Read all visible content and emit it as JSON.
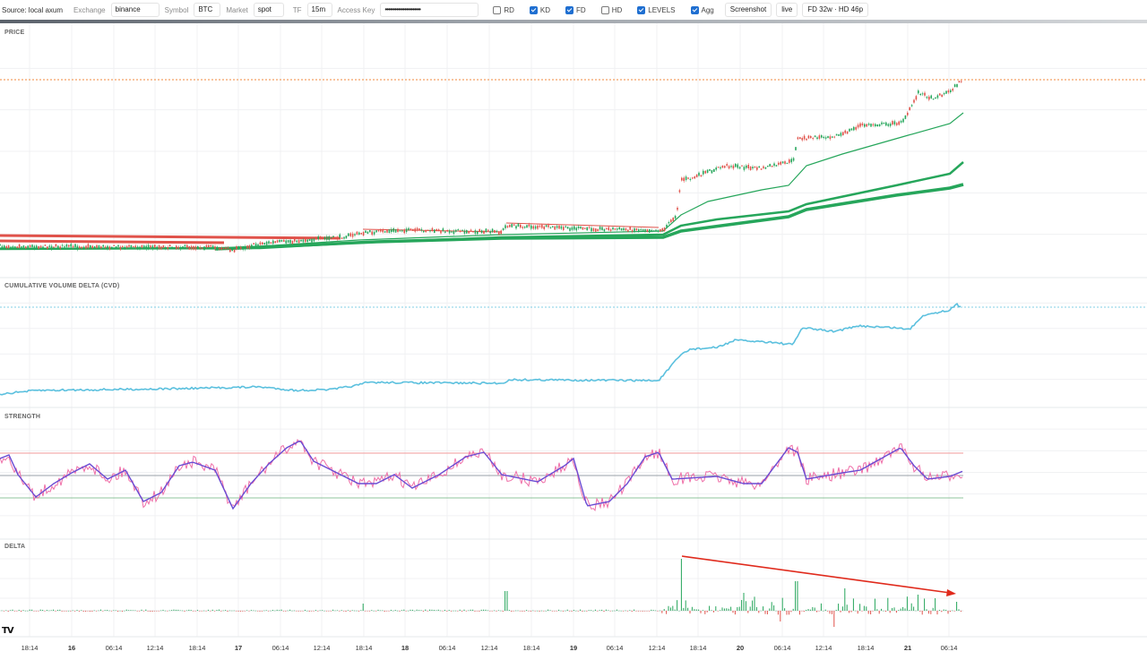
{
  "toolbar": {
    "source": "Source: local axum",
    "exchange_label": "Exchange",
    "exchange_value": "binance",
    "symbol_label": "Symbol",
    "symbol_value": "BTC",
    "market_label": "Market",
    "market_value": "spot",
    "tf_label": "TF",
    "tf_value": "15m",
    "access_key_label": "Access Key",
    "access_key_value": "••••••••••••••••••••••",
    "toggles": [
      {
        "label": "RD",
        "checked": false
      },
      {
        "label": "KD",
        "checked": true
      },
      {
        "label": "FD",
        "checked": true
      },
      {
        "label": "HD",
        "checked": false
      },
      {
        "label": "LEVELS",
        "checked": true
      },
      {
        "label": "Agg",
        "checked": true
      }
    ],
    "screenshot_button": "Screenshot",
    "live_button": "live",
    "status": "FD 32w · HD 46p"
  },
  "panels": {
    "price": "PRICE",
    "cvd": "CUMULATIVE VOLUME DELTA (CVD)",
    "strength": "STRENGTH",
    "delta": "DELTA"
  },
  "time_axis": [
    "18:14",
    "16",
    "06:14",
    "12:14",
    "18:14",
    "17",
    "06:14",
    "12:14",
    "18:14",
    "18",
    "06:14",
    "12:14",
    "18:14",
    "19",
    "06:14",
    "12:14",
    "18:14",
    "20",
    "06:14",
    "12:14",
    "18:14",
    "21",
    "06:14"
  ],
  "logo": "TV",
  "colors": {
    "up": "#26a65b",
    "down": "#e0524a",
    "cvd": "#5bc0de",
    "strength_fast": "#ef6fa8",
    "strength_slow": "#6a4bd3",
    "annotation": "#e02a1c",
    "last_price": "#f08a3c"
  }
}
